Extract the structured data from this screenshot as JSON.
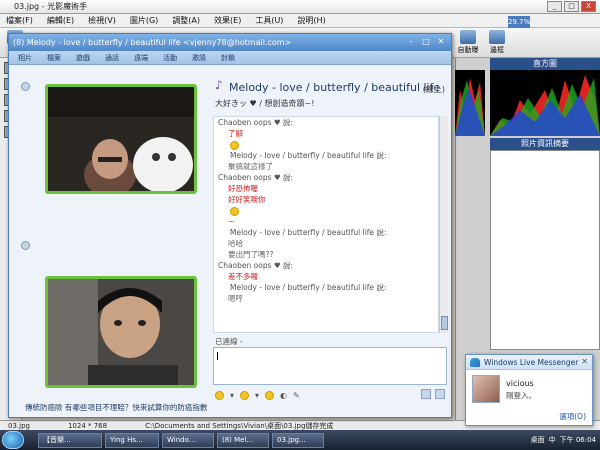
{
  "photo_app": {
    "title": "03.jpg - 光影魔術手",
    "menu": [
      "檔案(F)",
      "編輯(E)",
      "檢視(V)",
      "圖片(G)",
      "調整(A)",
      "效果(E)",
      "工具(U)",
      "說明(H)"
    ],
    "zoom": "29.7%",
    "toolbar_left": "開啟",
    "toolbar_right": [
      "自動曝",
      "邊框"
    ],
    "histogram_title": "直方圖",
    "info_title": "照片資訊摘要",
    "status": [
      "03.jpg",
      "1024 * 768",
      "C:\\Documents and Settings\\Vivian\\桌面\\03.jpg儲存完成"
    ]
  },
  "messenger": {
    "title": "(8) Melody - love / butterfly / beautiful life <vjenny78@hotmail.com>",
    "menu": [
      "相片",
      "檔案",
      "遊戲",
      "通話",
      "遠端",
      "活動",
      "邀請",
      "封鎖"
    ],
    "contact": {
      "name": "Melody - love / butterfly / beautiful life",
      "status": "(線上)",
      "psm": "大好きッ ♥ / 想創造奇蹟~!"
    },
    "chat": [
      {
        "kind": "sender",
        "text": "Chaoben oops ♥ 說:"
      },
      {
        "kind": "red",
        "text": "了解"
      },
      {
        "kind": "emo"
      },
      {
        "kind": "nick",
        "text": "Melody - love / butterfly / beautiful life 說:"
      },
      {
        "kind": "gray",
        "text": "聚搞就這樣了"
      },
      {
        "kind": "sender",
        "text": "Chaoben oops ♥ 說:"
      },
      {
        "kind": "red",
        "text": "好恐怖喔"
      },
      {
        "kind": "red",
        "text": "好好笑噢你"
      },
      {
        "kind": "emo"
      },
      {
        "kind": "red",
        "text": "~"
      },
      {
        "kind": "nick",
        "text": "Melody - love / butterfly / beautiful life 說:"
      },
      {
        "kind": "gray",
        "text": "哈哈"
      },
      {
        "kind": "gray",
        "text": "要出門了嗎??"
      },
      {
        "kind": "sender",
        "text": "Chaoben oops ♥ 說:"
      },
      {
        "kind": "red",
        "text": "差不多囉"
      },
      {
        "kind": "nick",
        "text": "Melody - love / butterfly / beautiful life 說:"
      },
      {
        "kind": "gray",
        "text": "嗯哼"
      }
    ],
    "typing_status": "已連線 -",
    "ad": "傳統防癌險 有哪些項目不理賠？快來試算你的防癌指數"
  },
  "notification": {
    "title": "Windows Live Messenger",
    "name": "vicious",
    "action": "剛登入。",
    "options": "選項(O)"
  },
  "taskbar": {
    "items": [
      "【音樂...",
      "Ying Hs...",
      "Windo...",
      "(8) Mel...",
      "03.jpg..."
    ],
    "tray": [
      "桌面",
      "中",
      "下午 06:04"
    ]
  }
}
